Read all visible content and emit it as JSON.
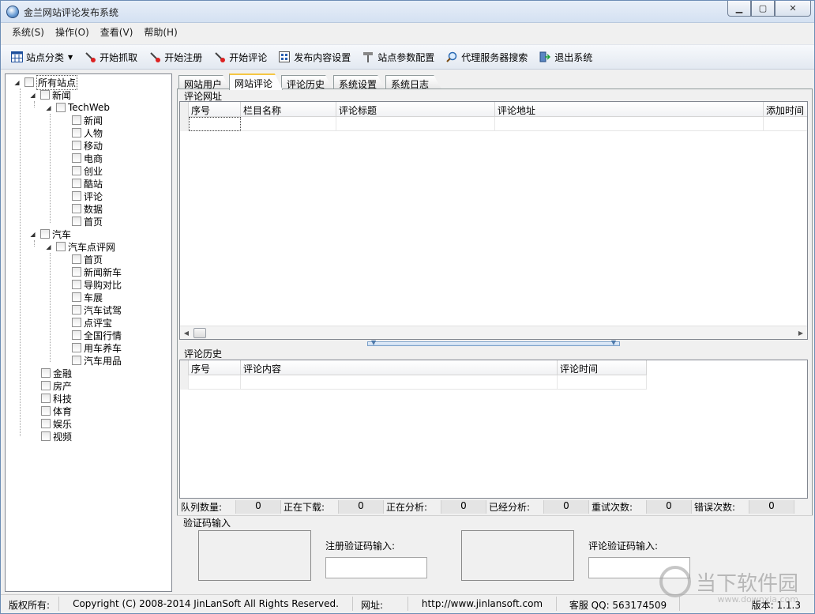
{
  "window": {
    "title": "金兰网站评论发布系统"
  },
  "menu": [
    "系统(S)",
    "操作(O)",
    "查看(V)",
    "帮助(H)"
  ],
  "toolbar": [
    {
      "label": "站点分类",
      "icon": "grid-icon",
      "dropdown": true
    },
    {
      "label": "开始抓取",
      "icon": "pin-icon"
    },
    {
      "label": "开始注册",
      "icon": "pin-icon"
    },
    {
      "label": "开始评论",
      "icon": "pin-icon"
    },
    {
      "label": "发布内容设置",
      "icon": "list-icon"
    },
    {
      "label": "站点参数配置",
      "icon": "wrench-icon"
    },
    {
      "label": "代理服务器搜索",
      "icon": "magnifier-icon"
    },
    {
      "label": "退出系统",
      "icon": "exit-icon"
    }
  ],
  "tree": {
    "root": "所有站点",
    "news": "新闻",
    "techweb": "TechWeb",
    "techweb_items": [
      "新闻",
      "人物",
      "移动",
      "电商",
      "创业",
      "酷站",
      "评论",
      "数据",
      "首页"
    ],
    "auto": "汽车",
    "autosite": "汽车点评网",
    "auto_items": [
      "首页",
      "新闻新车",
      "导购对比",
      "车展",
      "汽车试驾",
      "点评宝",
      "全国行情",
      "用车养车",
      "汽车用品"
    ],
    "others": [
      "金融",
      "房产",
      "科技",
      "体育",
      "娱乐",
      "视频"
    ]
  },
  "tabs": [
    "网站用户",
    "网站评论",
    "评论历史",
    "系统设置",
    "系统日志"
  ],
  "active_tab": "网站评论",
  "url_group": {
    "title": "评论网址",
    "columns": [
      "序号",
      "栏目名称",
      "评论标题",
      "评论地址",
      "添加时间"
    ]
  },
  "history_group": {
    "title": "评论历史",
    "columns": [
      "序号",
      "评论内容",
      "评论时间"
    ]
  },
  "counters": [
    {
      "label": "队列数量:",
      "value": "0"
    },
    {
      "label": "正在下载:",
      "value": "0"
    },
    {
      "label": "正在分析:",
      "value": "0"
    },
    {
      "label": "已经分析:",
      "value": "0"
    },
    {
      "label": "重试次数:",
      "value": "0"
    },
    {
      "label": "错误次数:",
      "value": "0"
    }
  ],
  "captcha": {
    "title": "验证码输入",
    "register_label": "注册验证码输入:",
    "comment_label": "评论验证码输入:"
  },
  "statusbar": {
    "copyright_label": "版权所有:",
    "copyright": "Copyright (C) 2008-2014 JinLanSoft All Rights Reserved.",
    "url_label": "网址:",
    "url": "http://www.jinlansoft.com",
    "qq": "客服 QQ:  563174509",
    "version": "版本:  1.1.3"
  },
  "watermark": {
    "text": "当下软件园",
    "url": "www.downxia.com"
  }
}
